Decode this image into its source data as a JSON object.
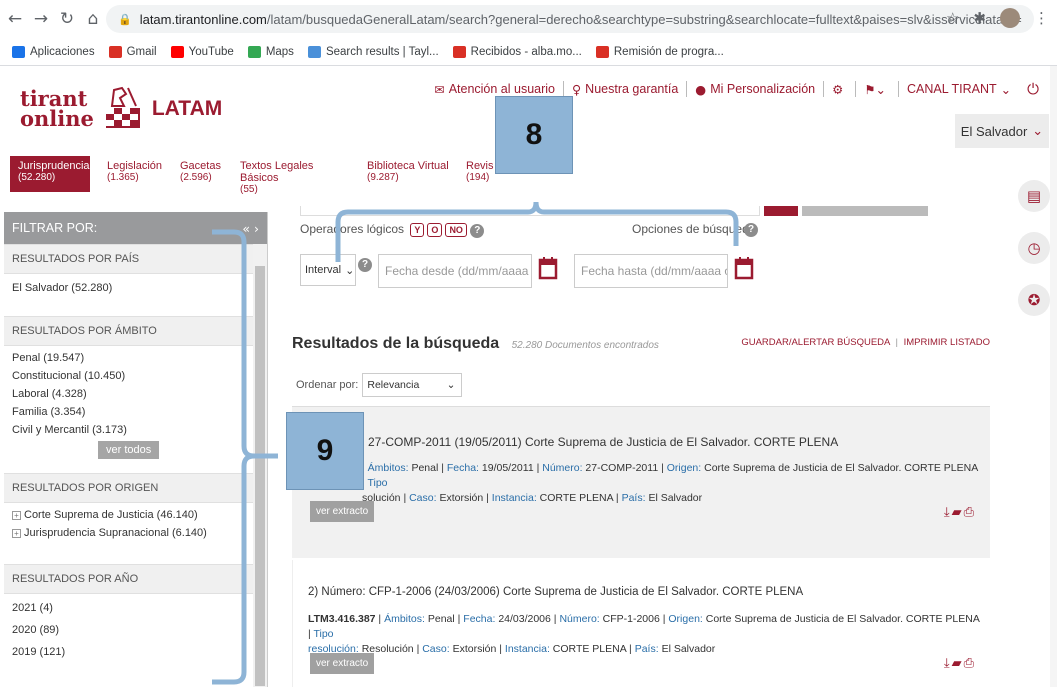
{
  "browser": {
    "url_host": "latam.tirantonline.com",
    "url_path": "/latam/busquedaGeneralLatam/search?general=derecho&searchtype=substring&searchlocate=fulltext&paises=slv&isservicelatam=",
    "bookmarks": [
      {
        "label": "Aplicaciones",
        "color": "#1a73e8"
      },
      {
        "label": "Gmail",
        "color": "#d93025"
      },
      {
        "label": "YouTube",
        "color": "#ff0000"
      },
      {
        "label": "Maps",
        "color": "#34a853"
      },
      {
        "label": "Search results | Tayl...",
        "color": "#4a90d9"
      },
      {
        "label": "Recibidos - alba.mo...",
        "color": "#d93025"
      },
      {
        "label": "Remisión de progra...",
        "color": "#d93025"
      }
    ]
  },
  "header": {
    "logo_line1": "tirant",
    "logo_line2": "online",
    "logo_latam": "LATAM",
    "links": {
      "attention": "Atención al usuario",
      "guarantee": "Nuestra garantía",
      "personalization": "Mi Personalización",
      "channel": "CANAL TIRANT"
    },
    "country": "El Salvador"
  },
  "tabs": [
    {
      "label": "Jurisprudencia",
      "count": "(52.280)"
    },
    {
      "label": "Legislación",
      "count": "(1.365)"
    },
    {
      "label": "Gacetas",
      "count": "(2.596)"
    },
    {
      "label": "Textos Legales Básicos",
      "count": "(55)"
    },
    {
      "label": "Biblioteca Virtual",
      "count": "(9.287)"
    },
    {
      "label": "Revis",
      "count": "(194)"
    }
  ],
  "sidebar": {
    "title": "FILTRAR POR:",
    "by_country": {
      "heading": "RESULTADOS POR PAÍS",
      "items": [
        "El Salvador (52.280)"
      ]
    },
    "by_scope": {
      "heading": "RESULTADOS POR ÁMBITO",
      "items": [
        "Penal (19.547)",
        "Constitucional (10.450)",
        "Laboral (4.328)",
        "Familia (3.354)",
        "Civil y Mercantil (3.173)"
      ],
      "see_all": "ver todos"
    },
    "by_origin": {
      "heading": "RESULTADOS POR ORIGEN",
      "items": [
        "Corte Suprema de Justicia (46.140)",
        "Jurisprudencia Supranacional (6.140)"
      ]
    },
    "by_year": {
      "heading": "RESULTADOS POR AÑO",
      "items": [
        "2021 (4)",
        "2020 (89)",
        "2019 (121)"
      ]
    }
  },
  "search": {
    "logical_ops_label": "Operadores lógicos",
    "ops": [
      "Y",
      "O",
      "NO"
    ],
    "search_options": "Opciones de búsqueda",
    "interval_value": "Interval",
    "date_from_placeholder": "Fecha desde (dd/mm/aaaa o",
    "date_to_placeholder": "Fecha hasta (dd/mm/aaaa o"
  },
  "results": {
    "title": "Resultados de la búsqueda",
    "count": "52.280 Documentos encontrados",
    "save_alert": "GUARDAR/ALERTAR BÚSQUEDA",
    "print_list": "IMPRIMIR LISTADO",
    "order_label": "Ordenar por:",
    "order_value": "Relevancia",
    "items": [
      {
        "title": "27-COMP-2011 (19/05/2011) Corte Suprema de Justicia de El Salvador. CORTE PLENA",
        "ref": "",
        "ambitos": "Penal",
        "fecha": "19/05/2011",
        "numero": "27-COMP-2011",
        "origen": "Corte Suprema de Justicia de El Salvador. CORTE PLENA",
        "tipo": "solución",
        "caso": "Extorsión",
        "instancia": "CORTE PLENA",
        "pais": "El Salvador",
        "extract_btn": "ver extracto"
      },
      {
        "title": "2)  Número: CFP-1-2006 (24/03/2006) Corte Suprema de Justicia de El Salvador. CORTE PLENA",
        "ref": "LTM3.416.387",
        "ambitos": "Penal",
        "fecha": "24/03/2006",
        "numero": "CFP-1-2006",
        "origen": "Corte Suprema de Justicia de El Salvador. CORTE PLENA",
        "tipo": "Resolución",
        "caso": "Extorsión",
        "instancia": "CORTE PLENA",
        "pais": "El Salvador",
        "extract_btn": "ver extracto"
      }
    ],
    "labels": {
      "ambitos": "Ámbitos:",
      "fecha": "Fecha:",
      "numero": "Número:",
      "origen": "Origen:",
      "tipo": "Tipo",
      "resolucion": "resolución:",
      "caso": "Caso:",
      "instancia": "Instancia:",
      "pais": "País:"
    }
  },
  "callouts": {
    "eight": "8",
    "nine": "9"
  },
  "colors": {
    "brand": "#9b1b30",
    "callout": "#8eb4d6",
    "bracket": "#8eb4d6"
  }
}
